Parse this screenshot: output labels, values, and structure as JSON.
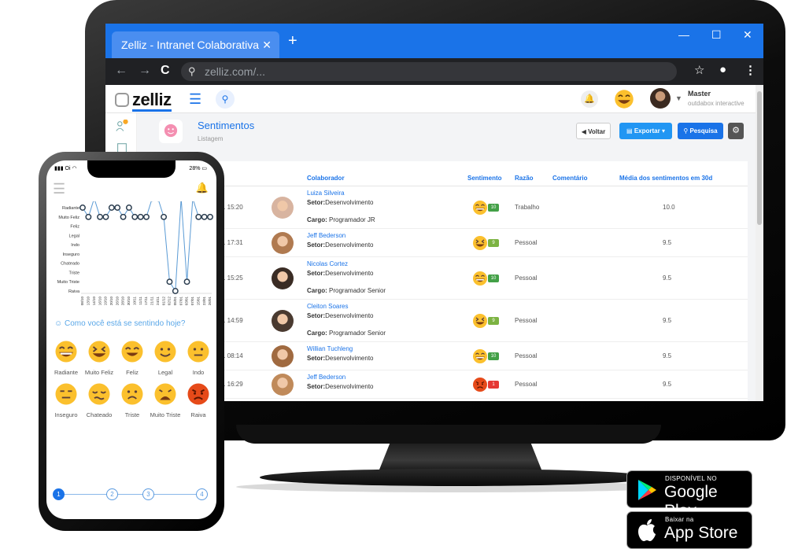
{
  "browser": {
    "tab_title": "Zelliz - Intranet Colaborativa",
    "tab_close": "✕",
    "new_tab": "+",
    "url": "zelliz.com/...",
    "win_min": "—",
    "win_max": "☐",
    "win_close": "✕"
  },
  "app": {
    "logo": "zelliz",
    "user_name": "Master",
    "user_org": "outdabox interactive"
  },
  "page": {
    "title": "Sentimentos",
    "subtitle": "Listagem",
    "btn_voltar": "Voltar",
    "btn_exportar": "Exportar",
    "btn_pesquisa": "Pesquisa"
  },
  "table": {
    "headers": {
      "colaborador": "Colaborador",
      "sentimento": "Sentimento",
      "razao": "Razão",
      "comentario": "Comentário",
      "media": "Média dos sentimentos em 30d"
    },
    "rows": [
      {
        "date": "1 15:20",
        "name": "Luiza Silveira",
        "setor_label": "Setor:",
        "setor": "Desenvolvimento",
        "cargo_label": "Cargo:",
        "cargo": "Programador JR",
        "mood_value": "10",
        "mood_color": "#43a047",
        "razao": "Trabalho",
        "media": "10.0"
      },
      {
        "date": "1 17:31",
        "name": "Jeff Bederson",
        "setor_label": "Setor:",
        "setor": "Desenvolvimento",
        "cargo_label": "",
        "cargo": "",
        "mood_value": "9",
        "mood_color": "#7cb342",
        "razao": "Pessoal",
        "media": "9.5"
      },
      {
        "date": "1 15:25",
        "name": "Nicolas Cortez",
        "setor_label": "Setor:",
        "setor": "Desenvolvimento",
        "cargo_label": "Cargo:",
        "cargo": "Programador Senior",
        "mood_value": "10",
        "mood_color": "#43a047",
        "razao": "Pessoal",
        "media": "9.5"
      },
      {
        "date": "1 14:59",
        "name": "Cleiton Soares",
        "setor_label": "Setor:",
        "setor": "Desenvolvimento",
        "cargo_label": "Cargo:",
        "cargo": "Programador Senior",
        "mood_value": "9",
        "mood_color": "#7cb342",
        "razao": "Pessoal",
        "media": "9.5"
      },
      {
        "date": "1 08:14",
        "name": "Willian Tuchleng",
        "setor_label": "Setor:",
        "setor": "Desenvolvimento",
        "cargo_label": "",
        "cargo": "",
        "mood_value": "10",
        "mood_color": "#43a047",
        "razao": "Pessoal",
        "media": "9.5"
      },
      {
        "date": "1 16:29",
        "name": "Jeff Bederson",
        "setor_label": "Setor:",
        "setor": "Desenvolvimento",
        "cargo_label": "",
        "cargo": "",
        "mood_value": "1",
        "mood_color": "#e53935",
        "razao": "Pessoal",
        "media": "9.5"
      }
    ]
  },
  "phone": {
    "carrier": "Oi",
    "battery": "28%",
    "question": "Como você está se sentindo hoje?",
    "chart_data": {
      "type": "line",
      "y_categories": [
        "Raiva",
        "Muito Triste",
        "Triste",
        "Chateado",
        "Inseguro",
        "Indo",
        "Legal",
        "Feliz",
        "Muito Feliz",
        "Radiante"
      ],
      "x": [
        "08/10",
        "13/10",
        "14/10",
        "16/10",
        "19/10",
        "20/10",
        "26/10",
        "28/10",
        "30/10",
        "10/11",
        "11/11",
        "17/11",
        "21/11",
        "24/11",
        "01/12",
        "02/12",
        "05/01",
        "07/01",
        "03/01",
        "07/01",
        "15/01",
        "23/01",
        "26/01"
      ],
      "values": [
        9,
        8,
        10,
        8,
        8,
        9,
        9,
        8,
        9,
        8,
        8,
        8,
        10,
        10,
        8,
        1,
        0,
        10,
        1,
        10,
        8,
        8,
        8
      ],
      "color": "#5b9bd5"
    },
    "moods": [
      {
        "label": "Radiante",
        "face": "radiante"
      },
      {
        "label": "Muito Feliz",
        "face": "muito-feliz"
      },
      {
        "label": "Feliz",
        "face": "feliz"
      },
      {
        "label": "Legal",
        "face": "legal"
      },
      {
        "label": "Indo",
        "face": "indo"
      },
      {
        "label": "Inseguro",
        "face": "inseguro"
      },
      {
        "label": "Chateado",
        "face": "chateado"
      },
      {
        "label": "Triste",
        "face": "triste"
      },
      {
        "label": "Muito Triste",
        "face": "muito-triste"
      },
      {
        "label": "Raiva",
        "face": "raiva"
      }
    ],
    "steps": [
      "1",
      "2",
      "3",
      "4"
    ]
  },
  "stores": {
    "google_small": "DISPONÍVEL NO",
    "google_big": "Google Play",
    "apple_small": "Baixar na",
    "apple_big": "App Store"
  }
}
